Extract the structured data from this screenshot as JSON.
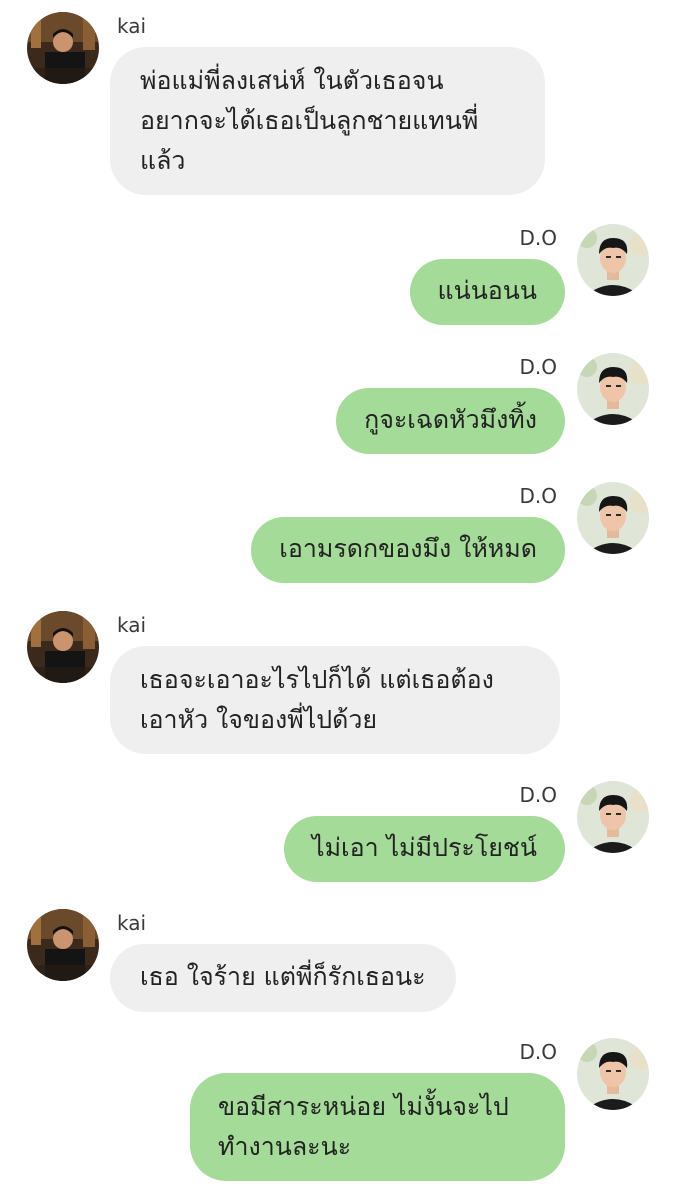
{
  "colors": {
    "incoming_bubble": "#efefef",
    "outgoing_bubble": "#a4db98",
    "text": "#222222",
    "name": "#3a3a3a"
  },
  "icons": {
    "kai_avatar": "profile-photo-kai",
    "do_avatar": "profile-photo-do"
  },
  "messages": [
    {
      "sender": "kai",
      "text": "พ่อแม่พี่ลงเสน่ห์ ในตัวเธอจน\nอยากจะได้เธอเป็นลูกชายแทนพี่\nแล้ว"
    },
    {
      "sender": "D.O",
      "text": "แน่นอนน"
    },
    {
      "sender": "D.O",
      "text": "กูจะเฉดหัวมึงทิ้ง"
    },
    {
      "sender": "D.O",
      "text": "เอามรดกของมึง ให้หมด"
    },
    {
      "sender": "kai",
      "text": "เธอจะเอาอะไรไปก็ได้ แต่เธอต้อง\nเอาหัว ใจของพี่ไปด้วย"
    },
    {
      "sender": "D.O",
      "text": "ไม่เอา ไม่มีประโยชน์"
    },
    {
      "sender": "kai",
      "text": "เธอ ใจร้าย แต่พี่ก็รักเธอนะ"
    },
    {
      "sender": "D.O",
      "text": "ขอมีสาระหน่อย ไม่งั้นจะไป\nทำงานละนะ"
    }
  ]
}
